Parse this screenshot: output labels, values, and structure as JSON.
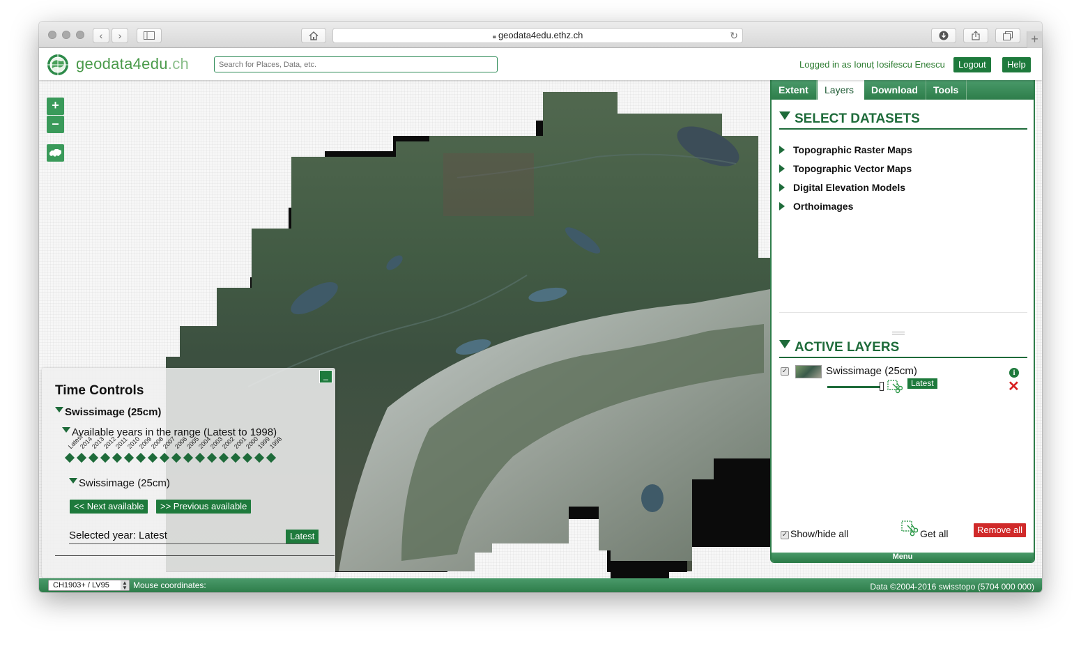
{
  "browser": {
    "url": "geodata4edu.ethz.ch",
    "new_tab": "+"
  },
  "header": {
    "logo_main": "geodata4edu",
    "logo_suffix": ".ch",
    "search_placeholder": "Search for Places, Data, etc.",
    "logged_in": "Logged in as Ionuț Iosifescu Enescu",
    "logout": "Logout",
    "help": "Help"
  },
  "map_controls": {
    "zoom_in": "+",
    "zoom_out": "–"
  },
  "time_controls": {
    "title": "Time Controls",
    "minimize": "_",
    "dataset": "Swissimage (25cm)",
    "range_label": "Available years in the range (Latest to 1998)",
    "years": [
      "Latest",
      "2014",
      "2013",
      "2012",
      "2011",
      "2010",
      "2009",
      "2008",
      "2007",
      "2006",
      "2005",
      "2004",
      "2003",
      "2002",
      "2001",
      "2000",
      "1999",
      "1998"
    ],
    "sub_dataset": "Swissimage (25cm)",
    "next_available": "<< Next available",
    "previous_available": ">> Previous available",
    "selected_year": "Selected year: Latest",
    "selected_badge": "Latest"
  },
  "side_panel": {
    "tabs": [
      {
        "label": "Extent"
      },
      {
        "label": "Layers"
      },
      {
        "label": "Download"
      },
      {
        "label": "Tools"
      }
    ],
    "select_datasets_title": "SELECT DATASETS",
    "datasets": [
      {
        "label": "Topographic Raster Maps"
      },
      {
        "label": "Topographic Vector Maps"
      },
      {
        "label": "Digital Elevation Models"
      },
      {
        "label": "Orthoimages"
      }
    ],
    "active_layers_title": "ACTIVE LAYERS",
    "layer": {
      "name": "Swissimage (25cm)",
      "info": "i",
      "remove": "✕",
      "time_tag": "Latest"
    },
    "show_hide_all": "Show/hide all",
    "get_all": "Get all",
    "remove_all": "Remove all",
    "menu": "Menu"
  },
  "footer": {
    "crs": "CH1903+ / LV95",
    "mouse_coordinates": "Mouse coordinates:",
    "copyright": "Data ©2004-2016 swisstopo (5704 000 000)"
  },
  "colors": {
    "brand_green": "#1e7a3c",
    "remove_red": "#d02a2a"
  }
}
